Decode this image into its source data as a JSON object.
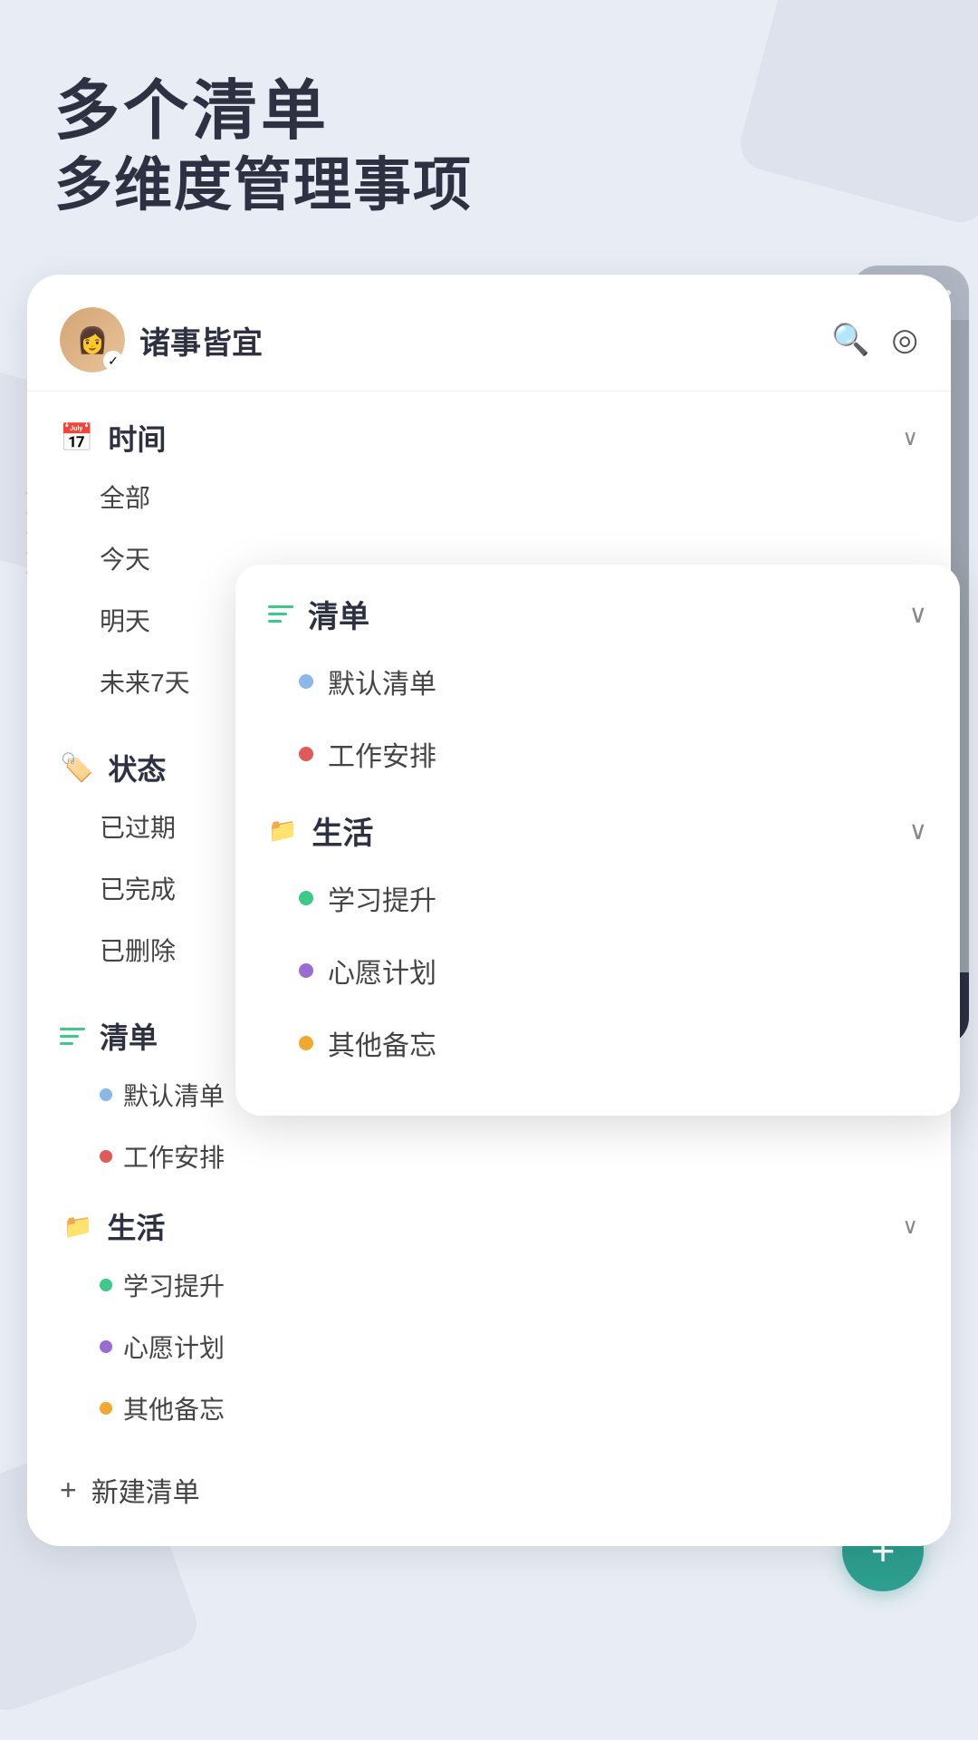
{
  "header": {
    "title_line1": "多个清单",
    "title_line2": "多维度管理事项"
  },
  "sidebar": {
    "username": "诸事皆宜",
    "search_icon": "🔍",
    "settings_icon": "◎",
    "sections": {
      "time": {
        "label": "时间",
        "items": [
          "全部",
          "今天",
          "明天",
          "未来7天"
        ]
      },
      "status": {
        "label": "状态",
        "items": [
          "已过期",
          "已完成",
          "已删除"
        ]
      },
      "lists": {
        "label": "清单",
        "items": [
          {
            "name": "默认清单",
            "dot_class": "dot-blue"
          },
          {
            "name": "工作安排",
            "dot_class": "dot-red"
          }
        ],
        "groups": [
          {
            "name": "生活",
            "items": [
              {
                "name": "学习提升",
                "dot_class": "dot-green"
              },
              {
                "name": "心愿计划",
                "dot_class": "dot-purple"
              },
              {
                "name": "其他备忘",
                "dot_class": "dot-yellow"
              }
            ]
          }
        ]
      }
    },
    "new_list_label": "新建清单"
  },
  "popup": {
    "section_label": "清单",
    "items": [
      {
        "name": "默认清单",
        "dot_class": "dot-blue"
      },
      {
        "name": "工作安排",
        "dot_class": "dot-red"
      }
    ],
    "groups": [
      {
        "name": "生活",
        "items": [
          {
            "name": "学习提升",
            "dot_class": "dot-green"
          },
          {
            "name": "心愿计划",
            "dot_class": "dot-purple"
          },
          {
            "name": "其他备忘",
            "dot_class": "dot-yellow"
          }
        ]
      }
    ]
  }
}
